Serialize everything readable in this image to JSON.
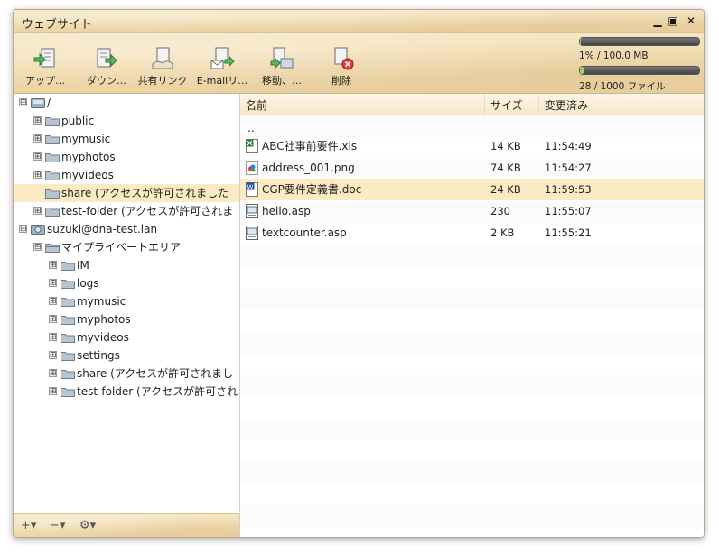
{
  "window": {
    "title": "ウェブサイト"
  },
  "toolbar": {
    "upload": "アップ…",
    "download": "ダウン…",
    "share_link": "共有リンク",
    "email_link": "E-mailリ…",
    "move": "移動、…",
    "delete": "削除"
  },
  "usage": {
    "storage_text": "1% / 100.0 MB",
    "storage_fraction": 0.01,
    "files_text": "28 / 1000 ファイル",
    "files_fraction": 0.028
  },
  "tree": [
    {
      "label": "/",
      "expander": "⊟"
    },
    {
      "label": "public",
      "expander": "⊞"
    },
    {
      "label": "mymusic",
      "expander": "⊞"
    },
    {
      "label": "myphotos",
      "expander": "⊞"
    },
    {
      "label": "myvideos",
      "expander": "⊞"
    },
    {
      "label": "share (アクセスが許可されました",
      "expander": ""
    },
    {
      "label": "test-folder (アクセスが許可されま",
      "expander": "⊞"
    },
    {
      "label": "suzuki@dna-test.lan",
      "expander": "⊟"
    },
    {
      "label": "マイプライベートエリア",
      "expander": "⊟"
    },
    {
      "label": "IM",
      "expander": "⊞"
    },
    {
      "label": "logs",
      "expander": "⊞"
    },
    {
      "label": "mymusic",
      "expander": "⊞"
    },
    {
      "label": "myphotos",
      "expander": "⊞"
    },
    {
      "label": "myvideos",
      "expander": "⊞"
    },
    {
      "label": "settings",
      "expander": "⊞"
    },
    {
      "label": "share (アクセスが許可されまし",
      "expander": "⊞"
    },
    {
      "label": "test-folder (アクセスが許可され",
      "expander": "⊞"
    }
  ],
  "tree_footer": {
    "add": "+▾",
    "remove": "−▾",
    "settings": "⚙▾"
  },
  "files": {
    "headers": {
      "name": "名前",
      "size": "サイズ",
      "modified": "変更済み"
    },
    "parent": "..",
    "rows": [
      {
        "name": "ABC社事前要件.xls",
        "size": "14 KB",
        "time": "11:54:49",
        "icon": "excel-icon"
      },
      {
        "name": "address_001.png",
        "size": "74 KB",
        "time": "11:54:27",
        "icon": "image-icon"
      },
      {
        "name": "CGP要件定義書.doc",
        "size": "24 KB",
        "time": "11:59:53",
        "icon": "word-icon"
      },
      {
        "name": "hello.asp",
        "size": "230",
        "time": "11:55:07",
        "icon": "asp-icon"
      },
      {
        "name": "textcounter.asp",
        "size": "2 KB",
        "time": "11:55:21",
        "icon": "asp-icon"
      }
    ]
  },
  "colors": {
    "selection": "#fbebc3",
    "accent": "#f1dcb0",
    "meter_fill": "#9cd36a"
  }
}
